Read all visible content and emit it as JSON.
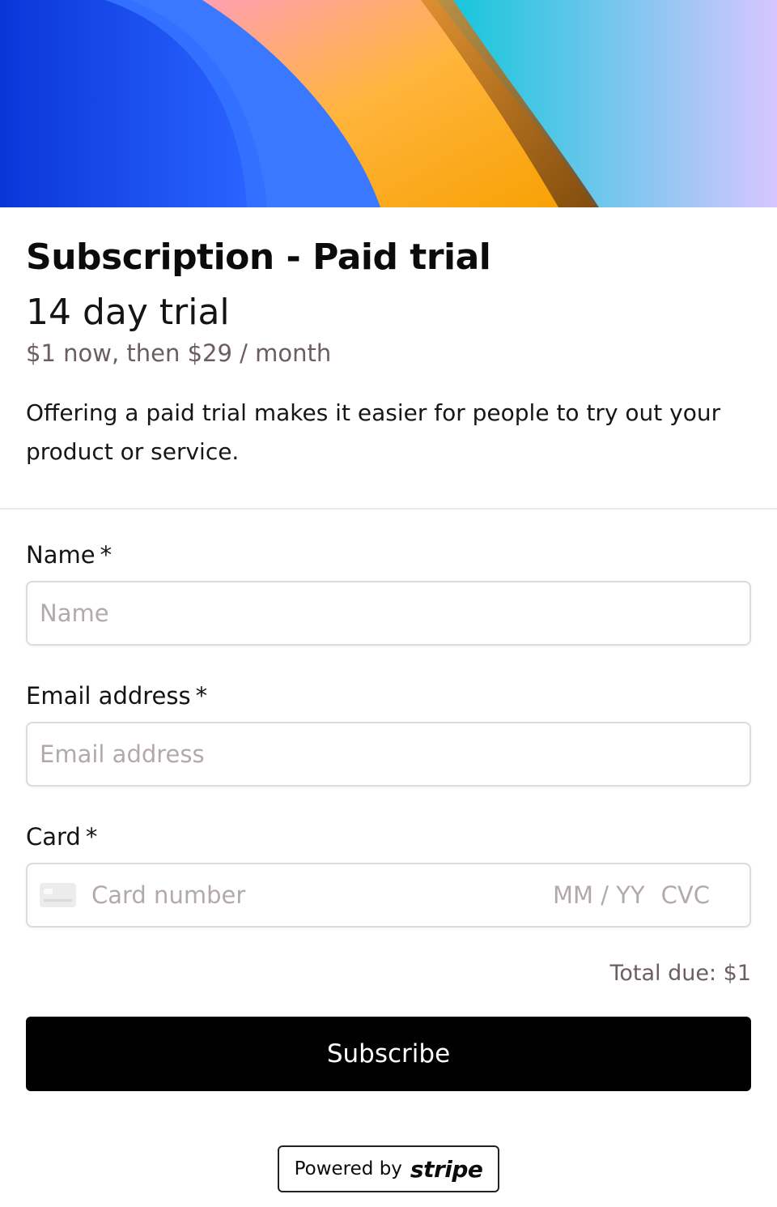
{
  "product": {
    "title": "Subscription - Paid trial",
    "trial": "14 day trial",
    "price": "$1 now, then $29 / month",
    "description": "Offering a paid trial makes it easier for people to try out your product or service."
  },
  "form": {
    "name_label": "Name",
    "name_placeholder": "Name",
    "email_label": "Email address",
    "email_placeholder": "Email address",
    "card_label": "Card",
    "card_number_placeholder": "Card number",
    "card_expiry_placeholder": "MM / YY",
    "card_cvc_placeholder": "CVC",
    "required_marker": "*"
  },
  "checkout": {
    "total_due": "Total due: $1",
    "subscribe_label": "Subscribe"
  },
  "footer": {
    "powered_by": "Powered by",
    "brand": "stripe"
  },
  "colors": {
    "button_bg": "#000000",
    "muted_text": "#6b5d62",
    "placeholder": "#b3a9ad"
  }
}
